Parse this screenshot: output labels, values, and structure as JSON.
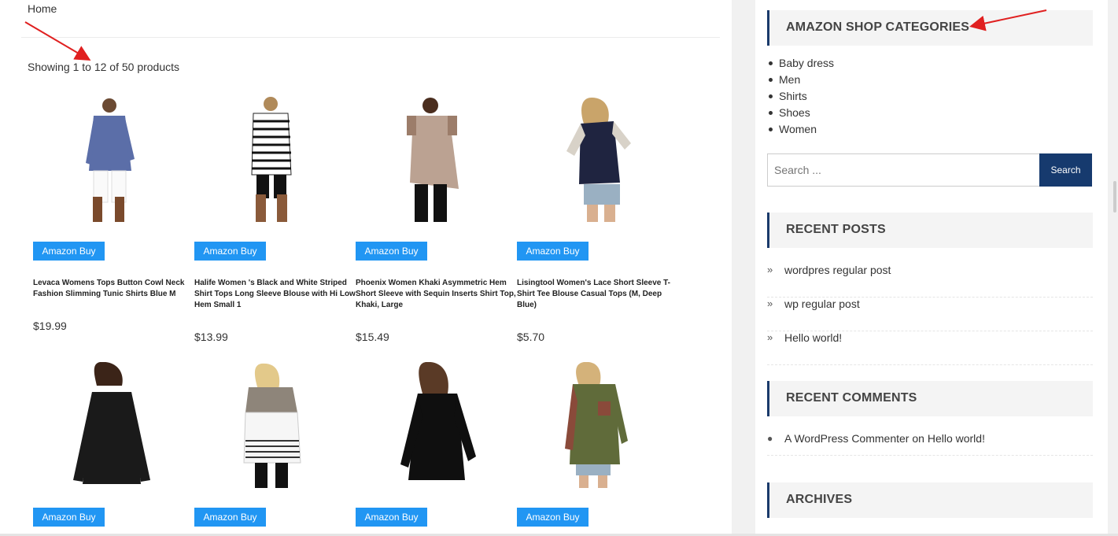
{
  "breadcrumb": "Home",
  "result_count": "Showing 1 to 12 of 50 products",
  "products": [
    {
      "buy_label": "Amazon Buy",
      "title": "Levaca Womens Tops Button Cowl Neck Fashion Slimming Tunic Shirts Blue M",
      "price": "$19.99"
    },
    {
      "buy_label": "Amazon Buy",
      "title": "Halife Women 's Black and White Striped Shirt Tops Long Sleeve Blouse with Hi Low Hem Small 1",
      "price": "$13.99"
    },
    {
      "buy_label": "Amazon Buy",
      "title": "Phoenix Women Khaki Asymmetric Hem Short Sleeve with Sequin Inserts Shirt Top, Khaki, Large",
      "price": "$15.49"
    },
    {
      "buy_label": "Amazon Buy",
      "title": "Lisingtool Women's Lace Short Sleeve T-Shirt Tee Blouse Casual Tops (M, Deep Blue)",
      "price": "$5.70"
    },
    {
      "buy_label": "Amazon Buy"
    },
    {
      "buy_label": "Amazon Buy"
    },
    {
      "buy_label": "Amazon Buy"
    },
    {
      "buy_label": "Amazon Buy"
    }
  ],
  "sidebar": {
    "categories_title": "AMAZON SHOP CATEGORIES",
    "categories": [
      "Baby dress",
      "Men",
      "Shirts",
      "Shoes",
      "Women"
    ],
    "search_placeholder": "Search ...",
    "search_button": "Search",
    "recent_posts_title": "RECENT POSTS",
    "recent_posts": [
      "wordpres regular post",
      "wp regular post",
      "Hello world!"
    ],
    "recent_comments_title": "RECENT COMMENTS",
    "recent_comment": {
      "author": "A WordPress Commenter",
      "on": " on ",
      "post": "Hello world!"
    },
    "archives_title": "ARCHIVES"
  },
  "colors": {
    "button_blue": "#2196f3",
    "search_navy": "#163a6e",
    "accent_border": "#1a3a6b",
    "arrow_red": "#e02020"
  }
}
